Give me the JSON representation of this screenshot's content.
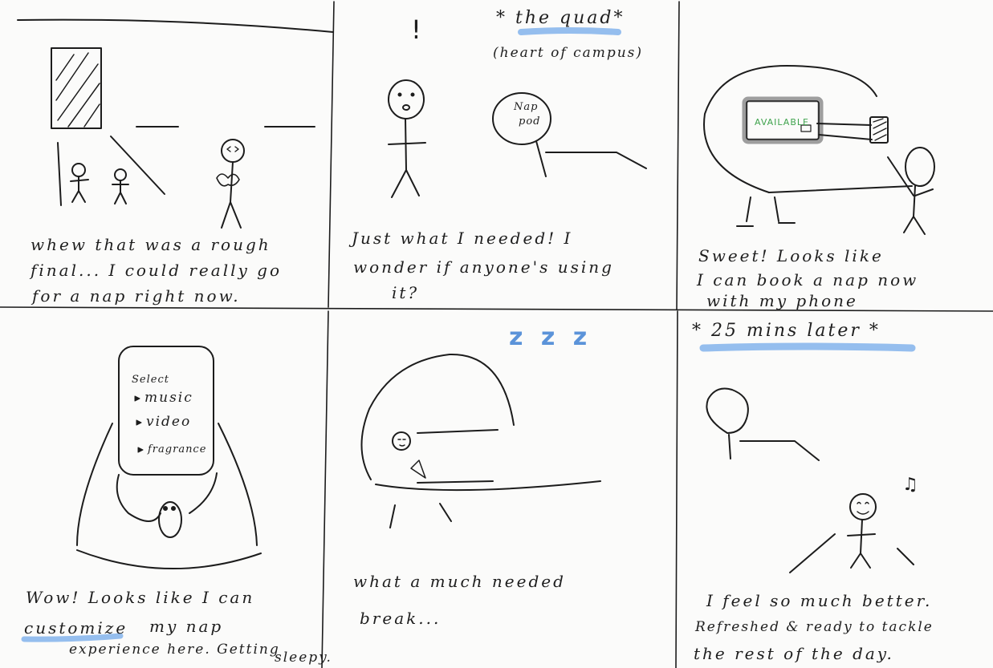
{
  "panel1": {
    "caption_lines": [
      "whew that was a rough",
      "final... I could really go",
      "for a nap right now."
    ]
  },
  "panel2": {
    "exclaim": "!",
    "location_title": "* the quad*",
    "location_subtitle": "(heart of campus)",
    "pod_label_lines": [
      "Nap",
      "pod"
    ],
    "caption_lines": [
      "Just what I needed! I",
      "wonder if anyone's using",
      "it?"
    ]
  },
  "panel3": {
    "screen_text": "AVAILABLE",
    "caption_lines": [
      "Sweet! Looks like",
      "I can book a nap now",
      "with my phone"
    ]
  },
  "panel4": {
    "menu_title": "Select",
    "menu_options": [
      "music",
      "video",
      "fragrance"
    ],
    "caption_line1": "Wow! Looks like I can",
    "caption_highlight": "customize",
    "caption_line2_rest": "my nap",
    "caption_line3": "experience here. Getting",
    "caption_line4": "sleepy."
  },
  "panel5": {
    "zzz": "z z z",
    "caption_lines": [
      "what a much needed",
      "break..."
    ]
  },
  "panel6": {
    "time_title": "* 25 mins later *",
    "music_note": "♫",
    "caption_lines": [
      "I feel so much better.",
      "Refreshed & ready to tackle",
      "the rest of the day."
    ]
  },
  "colors": {
    "ink": "#1c1c1c",
    "highlight_blue": "#8ab7ec",
    "zzz_blue": "#5b93d9",
    "screen_green": "#3fa34d"
  }
}
